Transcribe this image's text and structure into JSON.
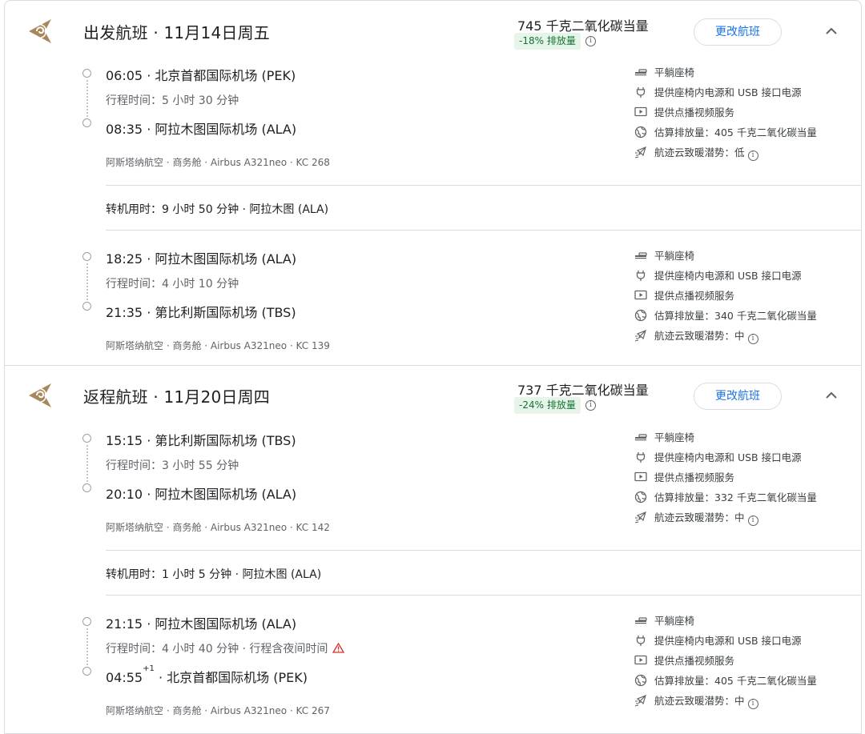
{
  "trips": [
    {
      "title": "出发航班 · 11月14日周五",
      "emissions": "745 千克二氧化碳当量",
      "emissions_badge": "-18% 排放量",
      "change_button": "更改航班",
      "layover": "转机用时：9 小时 50 分钟 · 阿拉木图 (ALA)",
      "segments": [
        {
          "departure": "06:05 · 北京首都国际机场 (PEK)",
          "duration": "行程时间：5 小时 30 分钟",
          "arrival": "08:35 · 阿拉木图国际机场 (ALA)",
          "meta": "阿斯塔纳航空 · 商务舱 · Airbus A321neo · KC 268",
          "amenities": [
            "平躺座椅",
            "提供座椅内电源和 USB 接口电源",
            "提供点播视频服务",
            "估算排放量：405 千克二氧化碳当量",
            "航迹云致暖潜势：低"
          ]
        },
        {
          "departure": "18:25 · 阿拉木图国际机场 (ALA)",
          "duration": "行程时间：4 小时 10 分钟",
          "arrival": "21:35 · 第比利斯国际机场 (TBS)",
          "meta": "阿斯塔纳航空 · 商务舱 · Airbus A321neo · KC 139",
          "amenities": [
            "平躺座椅",
            "提供座椅内电源和 USB 接口电源",
            "提供点播视频服务",
            "估算排放量：340 千克二氧化碳当量",
            "航迹云致暖潜势：中"
          ]
        }
      ]
    },
    {
      "title": "返程航班 · 11月20日周四",
      "emissions": "737 千克二氧化碳当量",
      "emissions_badge": "-24% 排放量",
      "change_button": "更改航班",
      "layover": "转机用时：1 小时 5 分钟 · 阿拉木图 (ALA)",
      "segments": [
        {
          "departure": "15:15 · 第比利斯国际机场 (TBS)",
          "duration": "行程时间：3 小时 55 分钟",
          "arrival": "20:10 · 阿拉木图国际机场 (ALA)",
          "meta": "阿斯塔纳航空 · 商务舱 · Airbus A321neo · KC 142",
          "amenities": [
            "平躺座椅",
            "提供座椅内电源和 USB 接口电源",
            "提供点播视频服务",
            "估算排放量：332 千克二氧化碳当量",
            "航迹云致暖潜势：中"
          ]
        },
        {
          "departure": "21:15 · 阿拉木图国际机场 (ALA)",
          "duration": "行程时间：4 小时 40 分钟 · 行程含夜间时间",
          "arrival_time": "04:55",
          "arrival_day_offset": "+1",
          "arrival_place": " · 北京首都国际机场 (PEK)",
          "meta": "阿斯塔纳航空 · 商务舱 · Airbus A321neo · KC 267",
          "amenities": [
            "平躺座椅",
            "提供座椅内电源和 USB 接口电源",
            "提供点播视频服务",
            "估算排放量：405 千克二氧化碳当量",
            "航迹云致暖潜势：中"
          ]
        }
      ]
    }
  ],
  "icons": {
    "amenity_icons": [
      "flat-bed-seat-icon",
      "power-plug-icon",
      "video-play-icon",
      "globe-emissions-icon",
      "contrail-plane-icon"
    ],
    "airline_logo": "air-astana-logo",
    "accent_color": "#1a73e8",
    "badge_color": "#137333",
    "logo_color": "#a8875a",
    "warning_color": "#d93025"
  }
}
